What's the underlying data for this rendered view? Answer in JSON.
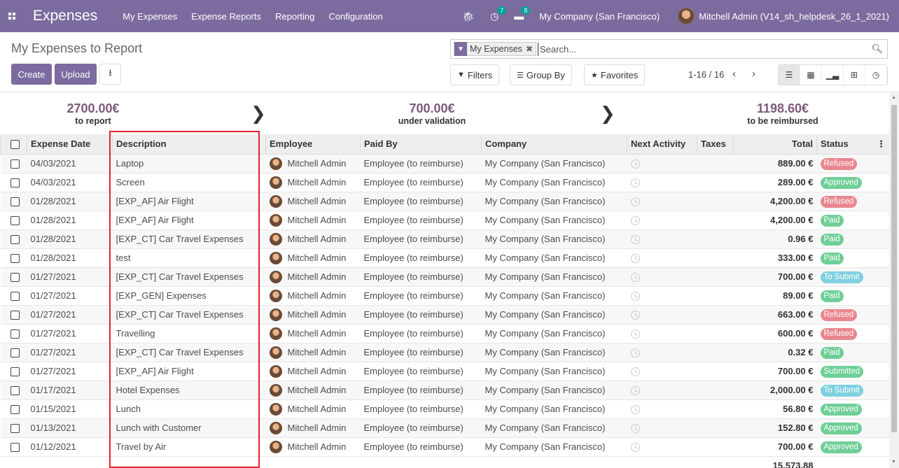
{
  "navbar": {
    "app_title": "Expenses",
    "menu": [
      "My Expenses",
      "Expense Reports",
      "Reporting",
      "Configuration"
    ],
    "activity_count": "7",
    "messages_count": "8",
    "company": "My Company (San Francisco)",
    "user": "Mitchell Admin (V14_sh_helpdesk_26_1_2021)"
  },
  "control_panel": {
    "title": "My Expenses to Report",
    "create_label": "Create",
    "upload_label": "Upload",
    "search_facet": "My Expenses",
    "search_placeholder": "Search...",
    "filters_label": "Filters",
    "groupby_label": "Group By",
    "favorites_label": "Favorites",
    "pager": "1-16 / 16"
  },
  "summary": [
    {
      "amount": "2700.00€",
      "label": "to report"
    },
    {
      "amount": "700.00€",
      "label": "under validation"
    },
    {
      "amount": "1198.60€",
      "label": "to be reimbursed"
    }
  ],
  "table": {
    "columns": [
      "Expense Date",
      "Description",
      "Employee",
      "Paid By",
      "Company",
      "Next Activity",
      "Taxes",
      "Total",
      "Status"
    ],
    "rows": [
      {
        "date": "04/03/2021",
        "description": "Laptop",
        "employee": "Mitchell Admin",
        "paid_by": "Employee (to reimburse)",
        "company": "My Company (San Francisco)",
        "total": "889.00 €",
        "status": "Refused"
      },
      {
        "date": "04/03/2021",
        "description": "Screen",
        "employee": "Mitchell Admin",
        "paid_by": "Employee (to reimburse)",
        "company": "My Company (San Francisco)",
        "total": "289.00 €",
        "status": "Approved"
      },
      {
        "date": "01/28/2021",
        "description": "[EXP_AF] Air Flight",
        "employee": "Mitchell Admin",
        "paid_by": "Employee (to reimburse)",
        "company": "My Company (San Francisco)",
        "total": "4,200.00 €",
        "status": "Refused"
      },
      {
        "date": "01/28/2021",
        "description": "[EXP_AF] Air Flight",
        "employee": "Mitchell Admin",
        "paid_by": "Employee (to reimburse)",
        "company": "My Company (San Francisco)",
        "total": "4,200.00 €",
        "status": "Paid"
      },
      {
        "date": "01/28/2021",
        "description": "[EXP_CT] Car Travel Expenses",
        "employee": "Mitchell Admin",
        "paid_by": "Employee (to reimburse)",
        "company": "My Company (San Francisco)",
        "total": "0.96 €",
        "status": "Paid"
      },
      {
        "date": "01/28/2021",
        "description": "test",
        "employee": "Mitchell Admin",
        "paid_by": "Employee (to reimburse)",
        "company": "My Company (San Francisco)",
        "total": "333.00 €",
        "status": "Paid"
      },
      {
        "date": "01/27/2021",
        "description": "[EXP_CT] Car Travel Expenses",
        "employee": "Mitchell Admin",
        "paid_by": "Employee (to reimburse)",
        "company": "My Company (San Francisco)",
        "total": "700.00 €",
        "status": "To Submit"
      },
      {
        "date": "01/27/2021",
        "description": "[EXP_GEN] Expenses",
        "employee": "Mitchell Admin",
        "paid_by": "Employee (to reimburse)",
        "company": "My Company (San Francisco)",
        "total": "89.00 €",
        "status": "Paid"
      },
      {
        "date": "01/27/2021",
        "description": "[EXP_CT] Car Travel Expenses",
        "employee": "Mitchell Admin",
        "paid_by": "Employee (to reimburse)",
        "company": "My Company (San Francisco)",
        "total": "663.00 €",
        "status": "Refused"
      },
      {
        "date": "01/27/2021",
        "description": "Travelling",
        "employee": "Mitchell Admin",
        "paid_by": "Employee (to reimburse)",
        "company": "My Company (San Francisco)",
        "total": "600.00 €",
        "status": "Refused"
      },
      {
        "date": "01/27/2021",
        "description": "[EXP_CT] Car Travel Expenses",
        "employee": "Mitchell Admin",
        "paid_by": "Employee (to reimburse)",
        "company": "My Company (San Francisco)",
        "total": "0.32 €",
        "status": "Paid"
      },
      {
        "date": "01/27/2021",
        "description": "[EXP_AF] Air Flight",
        "employee": "Mitchell Admin",
        "paid_by": "Employee (to reimburse)",
        "company": "My Company (San Francisco)",
        "total": "700.00 €",
        "status": "Submitted"
      },
      {
        "date": "01/17/2021",
        "description": "Hotel Expenses",
        "employee": "Mitchell Admin",
        "paid_by": "Employee (to reimburse)",
        "company": "My Company (San Francisco)",
        "total": "2,000.00 €",
        "status": "To Submit"
      },
      {
        "date": "01/15/2021",
        "description": "Lunch",
        "employee": "Mitchell Admin",
        "paid_by": "Employee (to reimburse)",
        "company": "My Company (San Francisco)",
        "total": "56.80 €",
        "status": "Approved"
      },
      {
        "date": "01/13/2021",
        "description": "Lunch with Customer",
        "employee": "Mitchell Admin",
        "paid_by": "Employee (to reimburse)",
        "company": "My Company (San Francisco)",
        "total": "152.80 €",
        "status": "Approved"
      },
      {
        "date": "01/12/2021",
        "description": "Travel by Air",
        "employee": "Mitchell Admin",
        "paid_by": "Employee (to reimburse)",
        "company": "My Company (San Francisco)",
        "total": "700.00 €",
        "status": "Approved"
      }
    ],
    "footer_total": "15,573.88"
  },
  "status_colors": {
    "Refused": "#e9868f",
    "Approved": "#6fcf97",
    "Paid": "#6fcf97",
    "To Submit": "#7fd0e0",
    "Submitted": "#6fcf97"
  },
  "accent_color": "#7c6b9e",
  "highlight_color": "#e3232d"
}
